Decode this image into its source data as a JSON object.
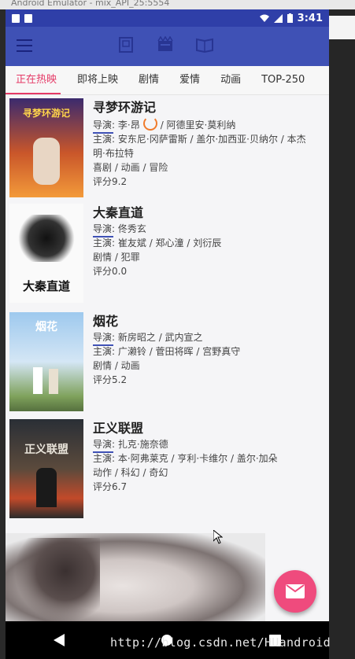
{
  "emulator_title": "Android Emulator - mix_API_25:5554",
  "status_bar": {
    "time": "3:41"
  },
  "toolbar": {
    "icons": [
      "book-icon",
      "movie-icon",
      "open-book-icon"
    ]
  },
  "tabs": [
    {
      "label": "正在热映",
      "active": true
    },
    {
      "label": "即将上映",
      "active": false
    },
    {
      "label": "剧情",
      "active": false
    },
    {
      "label": "爱情",
      "active": false
    },
    {
      "label": "动画",
      "active": false
    },
    {
      "label": "TOP-250",
      "active": false
    }
  ],
  "movies": [
    {
      "title": "寻梦环游记",
      "director_label": "导演:",
      "director": "李·昂",
      "director_rest": "/ 阿德里安·莫利纳",
      "cast_label": "主演:",
      "cast": "安东尼·冈萨雷斯 / 盖尔·加西亚·贝纳尔 / 本杰明·布拉特",
      "genres": "喜剧 / 动画 / 冒险",
      "rating": "评分9.2",
      "poster_text": "寻梦环游记"
    },
    {
      "title": "大秦直道",
      "director_label": "导演:",
      "director": "佟秀玄",
      "director_rest": "",
      "cast_label": "主演:",
      "cast": "崔友斌 / 郑心潼 / 刘衍辰",
      "genres": "剧情 / 犯罪",
      "rating": "评分0.0",
      "poster_text": "大秦直道"
    },
    {
      "title": "烟花",
      "director_label": "导演:",
      "director": "新房昭之 / 武内宣之",
      "director_rest": "",
      "cast_label": "主演:",
      "cast": "广濑铃 / 菅田将晖 / 宫野真守",
      "genres": "剧情 / 动画",
      "rating": "评分5.2",
      "poster_text": "烟花"
    },
    {
      "title": "正义联盟",
      "director_label": "导演:",
      "director": "扎克·施奈德",
      "director_rest": "",
      "cast_label": "主演:",
      "cast": "本·阿弗莱克 / 亨利·卡维尔 / 盖尔·加朵",
      "genres": "动作 / 科幻 / 奇幻",
      "rating": "评分6.7",
      "poster_text": "正义联盟"
    }
  ],
  "watermark": "http://blog.csdn.net/HUandroid",
  "colors": {
    "primary": "#3f51b5",
    "status_bar": "#2f3fa8",
    "accent": "#e53966",
    "fab": "#ef4b7d"
  }
}
